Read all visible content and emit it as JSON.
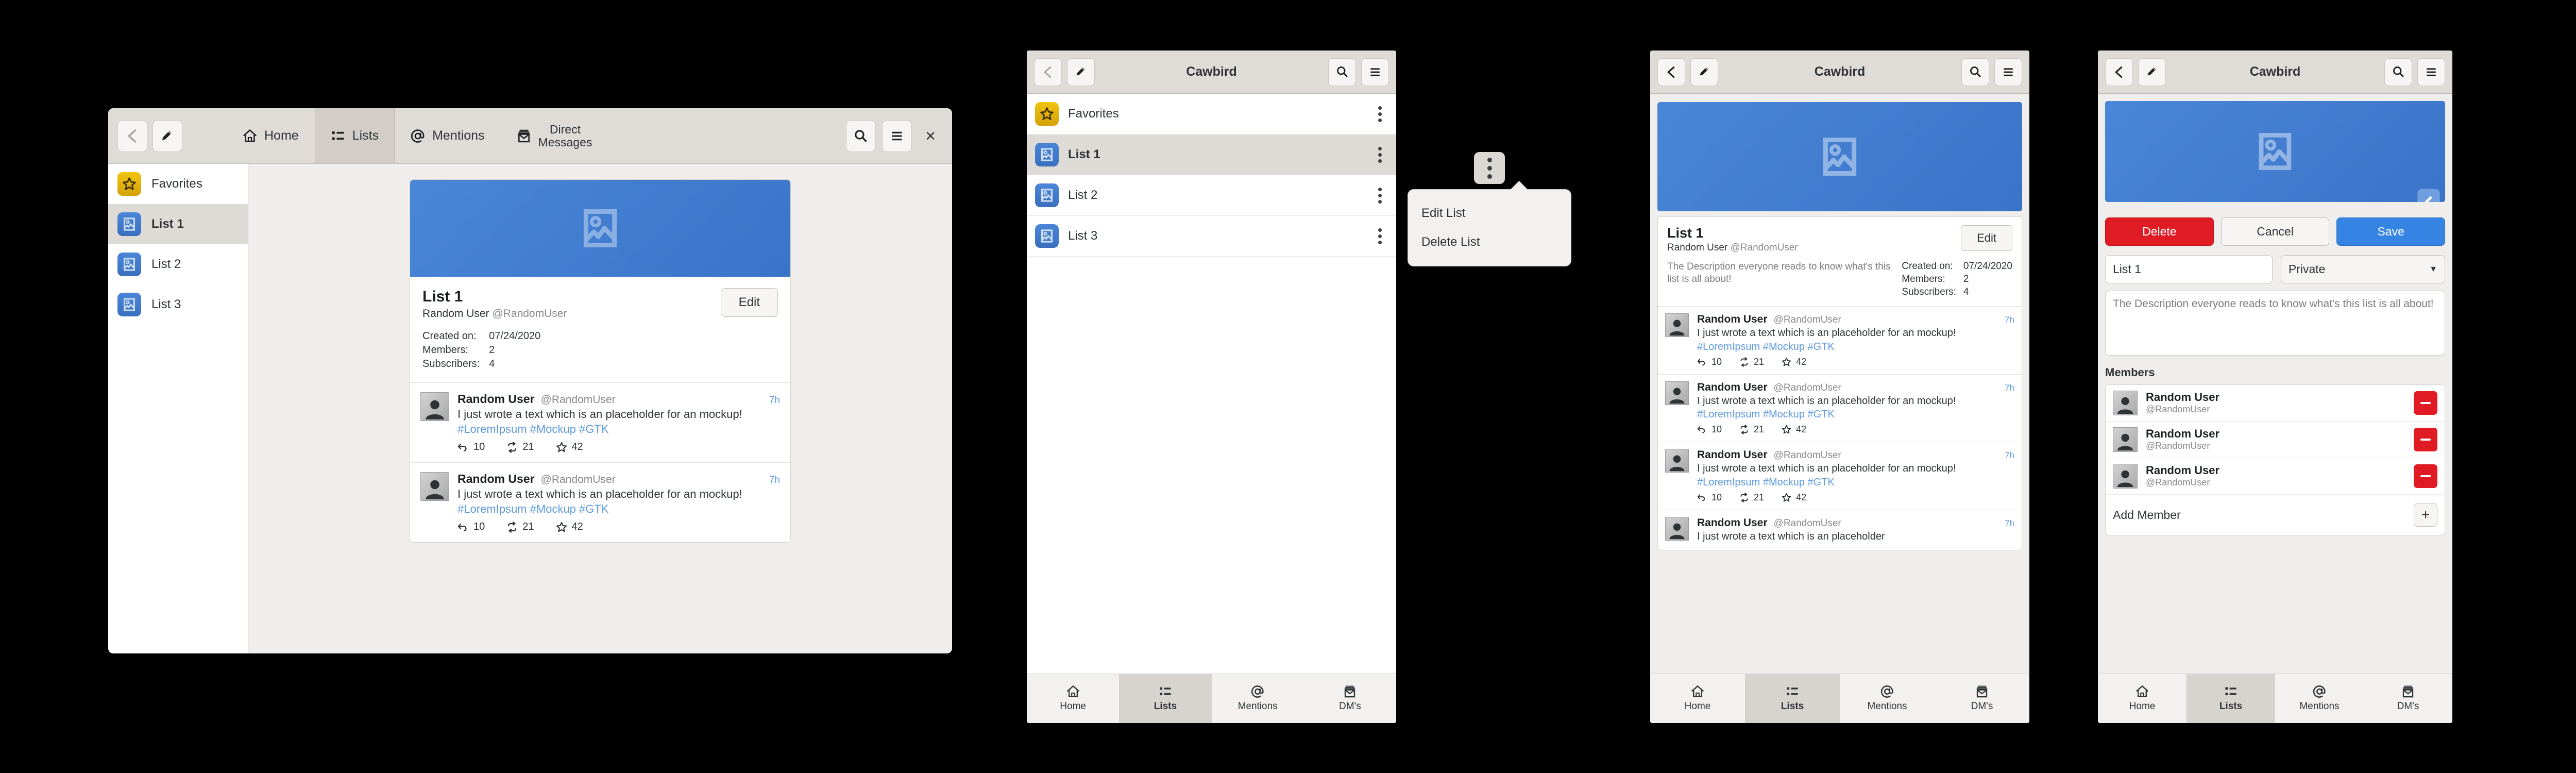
{
  "app": {
    "name": "Cawbird"
  },
  "desktop": {
    "header": {
      "back_icon": "chevron-left-icon",
      "compose_icon": "pencil-icon",
      "search_icon": "search-icon",
      "menu_icon": "hamburger-icon",
      "close_label": "×"
    },
    "tabs": [
      {
        "label": "Home",
        "icon": "home-icon",
        "selected": false
      },
      {
        "label": "Lists",
        "icon": "lists-icon",
        "selected": true
      },
      {
        "label": "Mentions",
        "icon": "at-icon",
        "selected": false
      },
      {
        "label": "Direct\nMessages",
        "icon": "envelope-icon",
        "selected": false
      }
    ],
    "sidebar": [
      {
        "label": "Favorites",
        "icon": "star-icon",
        "kind": "fav",
        "selected": false
      },
      {
        "label": "List 1",
        "icon": "image-icon",
        "kind": "img",
        "selected": true
      },
      {
        "label": "List 2",
        "icon": "image-icon",
        "kind": "img",
        "selected": false
      },
      {
        "label": "List 3",
        "icon": "image-icon",
        "kind": "img",
        "selected": false
      }
    ],
    "list": {
      "name": "List 1",
      "owner_name": "Random User",
      "owner_handle": "@RandomUser",
      "edit_label": "Edit",
      "meta": [
        {
          "key": "Created on:",
          "value": "07/24/2020"
        },
        {
          "key": "Members:",
          "value": "2"
        },
        {
          "key": "Subscribers:",
          "value": "4"
        }
      ]
    },
    "tweets": [
      {
        "name": "Random User",
        "handle": "@RandomUser",
        "time": "7h",
        "text": "I just wrote a text which is an placeholder for an mockup!",
        "tags": "#LoremIpsum #Mockup #GTK",
        "replies": "10",
        "retweets": "21",
        "favorites": "42"
      },
      {
        "name": "Random User",
        "handle": "@RandomUser",
        "time": "7h",
        "text": "I just wrote a text which is an placeholder for an mockup!",
        "tags": "#LoremIpsum #Mockup #GTK",
        "replies": "10",
        "retweets": "21",
        "favorites": "42"
      }
    ]
  },
  "phone_lists": {
    "title": "Cawbird",
    "rows": [
      {
        "label": "Favorites",
        "kind": "fav",
        "selected": false
      },
      {
        "label": "List 1",
        "kind": "img",
        "selected": true
      },
      {
        "label": "List 2",
        "kind": "img",
        "selected": false
      },
      {
        "label": "List 3",
        "kind": "img",
        "selected": false
      }
    ]
  },
  "popover": {
    "items": [
      {
        "label": "Edit List"
      },
      {
        "label": "Delete List"
      }
    ]
  },
  "phone_detail": {
    "title": "Cawbird",
    "list": {
      "name": "List 1",
      "owner_name": "Random User",
      "owner_handle": "@RandomUser",
      "edit_label": "Edit",
      "description": "The Description everyone reads to know what's this list is all about!",
      "meta": [
        {
          "key": "Created on:",
          "value": "07/24/2020"
        },
        {
          "key": "Members:",
          "value": "2"
        },
        {
          "key": "Subscribers:",
          "value": "4"
        }
      ]
    },
    "tweets": [
      {
        "name": "Random User",
        "handle": "@RandomUser",
        "time": "7h",
        "text": "I just wrote a text which is an placeholder for an mockup!",
        "tags": "#LoremIpsum #Mockup #GTK",
        "replies": "10",
        "retweets": "21",
        "favorites": "42"
      },
      {
        "name": "Random User",
        "handle": "@RandomUser",
        "time": "7h",
        "text": "I just wrote a text which is an placeholder for an mockup!",
        "tags": "#LoremIpsum #Mockup #GTK",
        "replies": "10",
        "retweets": "21",
        "favorites": "42"
      },
      {
        "name": "Random User",
        "handle": "@RandomUser",
        "time": "7h",
        "text": "I just wrote a text which is an placeholder for an mockup!",
        "tags": "#LoremIpsum #Mockup #GTK",
        "replies": "10",
        "retweets": "21",
        "favorites": "42"
      },
      {
        "name": "Random User",
        "handle": "@RandomUser",
        "time": "7h",
        "text": "I just wrote a text which is an placeholder",
        "tags": "",
        "replies": "",
        "retweets": "",
        "favorites": ""
      }
    ]
  },
  "phone_edit": {
    "title": "Cawbird",
    "banner_edit_icon": "pencil-icon",
    "buttons": {
      "delete": "Delete",
      "cancel": "Cancel",
      "save": "Save"
    },
    "name_value": "List 1",
    "privacy_value": "Private",
    "description_value": "The Description everyone reads to know what's this list is all about!",
    "members_heading": "Members",
    "members": [
      {
        "name": "Random User",
        "handle": "@RandomUser"
      },
      {
        "name": "Random User",
        "handle": "@RandomUser"
      },
      {
        "name": "Random User",
        "handle": "@RandomUser"
      }
    ],
    "add_member_label": "Add Member",
    "add_icon": "plus-icon",
    "remove_icon": "minus-icon"
  },
  "bottom_nav": [
    {
      "label": "Home",
      "icon": "home-icon",
      "selected": false
    },
    {
      "label": "Lists",
      "icon": "lists-icon",
      "selected": true
    },
    {
      "label": "Mentions",
      "icon": "at-icon",
      "selected": false
    },
    {
      "label": "DM's",
      "icon": "envelope-icon",
      "selected": false
    }
  ],
  "colors": {
    "accent_blue": "#3584e4",
    "banner_blue": "#4a86d8",
    "danger_red": "#e01b24",
    "favorite_gold": "#d4a206",
    "link_blue": "#5d9ae0"
  }
}
